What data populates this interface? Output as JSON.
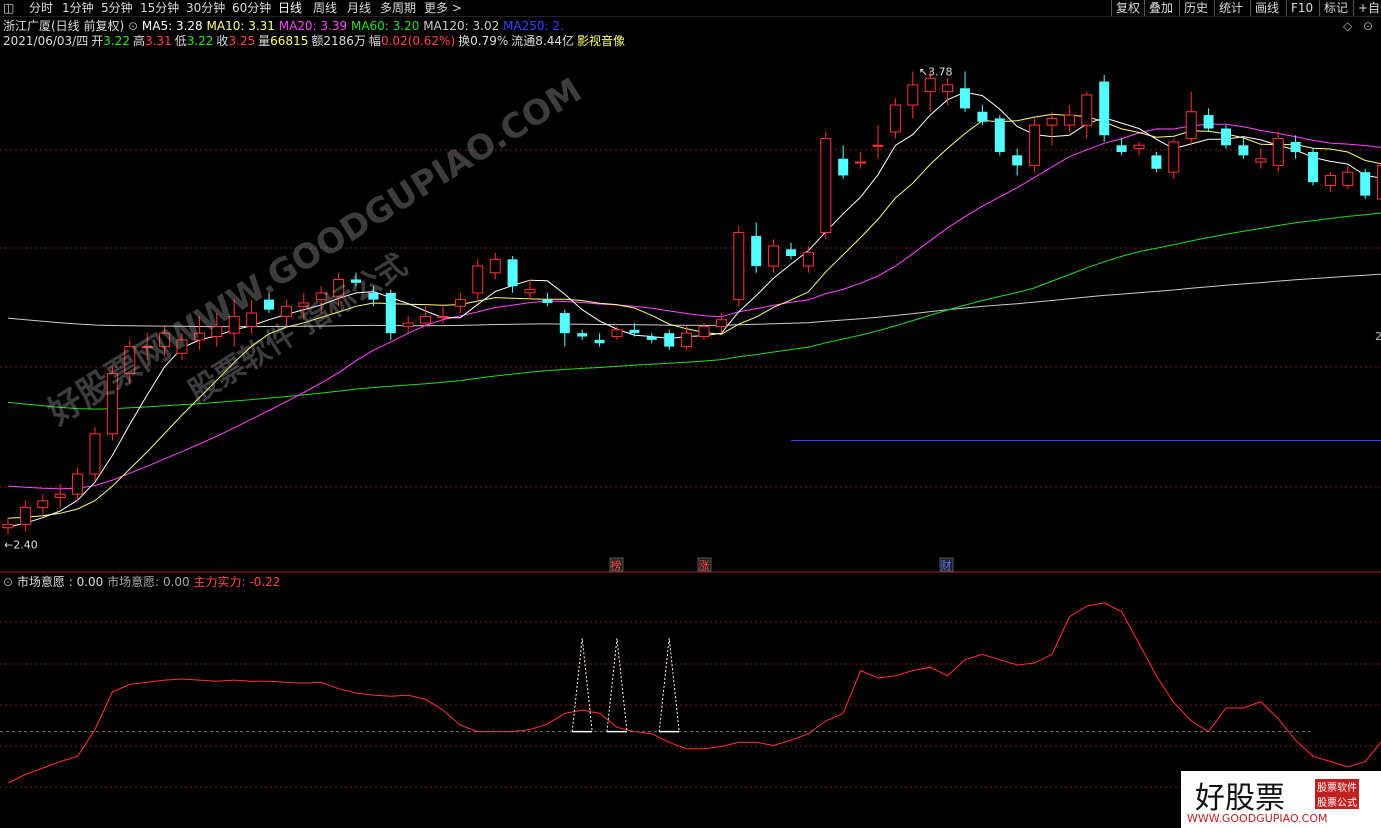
{
  "toolbar": {
    "window_icon": "window-icon",
    "periods": [
      "分时",
      "1分钟",
      "5分钟",
      "15分钟",
      "30分钟",
      "60分钟",
      "日线",
      "周线",
      "月线",
      "多周期",
      "更多 >"
    ],
    "active_period": "日线",
    "right_buttons": [
      "复权",
      "叠加",
      "历史",
      "统计",
      "画线",
      "F10",
      "标记",
      "+自选"
    ]
  },
  "main_info": {
    "title": "浙江广厦(日线 前复权)",
    "ma": [
      {
        "label": "MA5: 3.28",
        "color": "#ffffff"
      },
      {
        "label": "MA10: 3.31",
        "color": "#ffff80"
      },
      {
        "label": "MA20: 3.39",
        "color": "#ff44ff"
      },
      {
        "label": "MA60: 3.20",
        "color": "#22dd22"
      },
      {
        "label": "MA120: 3.02",
        "color": "#cccccc"
      },
      {
        "label": "MA250: 2.",
        "color": "#3344ff"
      }
    ],
    "quote": [
      {
        "label": "2021/06/03/四",
        "color": "#dddddd"
      },
      {
        "label": "开",
        "color": "#dddddd"
      },
      {
        "label": "3.22",
        "color": "#22ee22"
      },
      {
        "label": "高",
        "color": "#dddddd"
      },
      {
        "label": "3.31",
        "color": "#ff4444"
      },
      {
        "label": "低",
        "color": "#dddddd"
      },
      {
        "label": "3.22",
        "color": "#22ee22"
      },
      {
        "label": "收",
        "color": "#dddddd"
      },
      {
        "label": "3.25",
        "color": "#ff4444"
      },
      {
        "label": "量",
        "color": "#dddddd"
      },
      {
        "label": "66815",
        "color": "#ffff66"
      },
      {
        "label": "额",
        "color": "#dddddd"
      },
      {
        "label": "2186万",
        "color": "#dddddd"
      },
      {
        "label": "幅",
        "color": "#dddddd"
      },
      {
        "label": "0.02(0.62%)",
        "color": "#ff4444"
      },
      {
        "label": "换0.79%",
        "color": "#dddddd"
      },
      {
        "label": "流通8.44亿",
        "color": "#dddddd"
      },
      {
        "label": "影视音像",
        "color": "#ffff66"
      }
    ],
    "high_label": "3.78",
    "low_label": "2.40",
    "right_axis_label": "2",
    "events": [
      {
        "label": "榜",
        "color": "#ff4444"
      },
      {
        "label": "涨",
        "color": "#ff4444"
      },
      {
        "label": "财",
        "color": "#5577ff"
      }
    ]
  },
  "sub_info": {
    "indicator": "市场意愿",
    "items": [
      {
        "label": "市场意愿 : 0.00",
        "color": "#dddddd"
      },
      {
        "label": "市场意愿: 0.00",
        "color": "#aaaaaa"
      },
      {
        "label": "主力实力: -0.22",
        "color": "#ff4444"
      }
    ]
  },
  "watermark": {
    "lines": [
      "好股票网WWW.GOODGUPIAO.COM",
      "股票软件 指标公式"
    ],
    "logo_text": "好股票",
    "logo_tags": [
      "股票软件",
      "股票公式"
    ],
    "logo_url": "WWW.GOODGUPIAO.COM"
  },
  "colors": {
    "up": "#ff3333",
    "down": "#54ffff",
    "grid": "#7a1a1a",
    "ma5": "#ffffff",
    "ma10": "#ffff80",
    "ma20": "#ff44ff",
    "ma60": "#22dd22",
    "ma120": "#cccccc",
    "ma250": "#3344ff",
    "indicator_line": "#ff3333",
    "indicator_spike": "#ffffff"
  },
  "chart_data": {
    "type": "candlestick",
    "title": "浙江广厦(日线 前复权)",
    "y_range": [
      2.3,
      3.85
    ],
    "candles": [
      [
        2.42,
        2.45,
        2.4,
        2.43
      ],
      [
        2.43,
        2.5,
        2.41,
        2.48
      ],
      [
        2.48,
        2.52,
        2.46,
        2.5
      ],
      [
        2.51,
        2.55,
        2.48,
        2.52
      ],
      [
        2.52,
        2.6,
        2.5,
        2.58
      ],
      [
        2.58,
        2.72,
        2.56,
        2.7
      ],
      [
        2.7,
        2.9,
        2.68,
        2.88
      ],
      [
        2.88,
        2.98,
        2.85,
        2.96
      ],
      [
        2.96,
        3.0,
        2.92,
        2.96
      ],
      [
        2.96,
        3.02,
        2.93,
        3.0
      ],
      [
        2.94,
        3.0,
        2.92,
        2.98
      ],
      [
        2.98,
        3.05,
        2.95,
        3.0
      ],
      [
        2.99,
        3.06,
        2.96,
        3.02
      ],
      [
        3.0,
        3.1,
        2.96,
        3.05
      ],
      [
        3.02,
        3.1,
        3.0,
        3.06
      ],
      [
        3.1,
        3.12,
        3.06,
        3.07
      ],
      [
        3.05,
        3.1,
        3.02,
        3.08
      ],
      [
        3.08,
        3.12,
        3.04,
        3.09
      ],
      [
        3.1,
        3.14,
        3.06,
        3.12
      ],
      [
        3.11,
        3.18,
        3.08,
        3.16
      ],
      [
        3.16,
        3.18,
        3.14,
        3.15
      ],
      [
        3.12,
        3.14,
        3.08,
        3.1
      ],
      [
        3.12,
        3.13,
        2.98,
        3.0
      ],
      [
        3.02,
        3.05,
        3.0,
        3.03
      ],
      [
        3.03,
        3.08,
        3.02,
        3.05
      ],
      [
        3.05,
        3.08,
        3.03,
        3.05
      ],
      [
        3.08,
        3.12,
        3.06,
        3.1
      ],
      [
        3.12,
        3.22,
        3.1,
        3.2
      ],
      [
        3.18,
        3.24,
        3.16,
        3.22
      ],
      [
        3.22,
        3.23,
        3.12,
        3.14
      ],
      [
        3.12,
        3.16,
        3.1,
        3.13
      ],
      [
        3.1,
        3.12,
        3.08,
        3.09
      ],
      [
        3.06,
        3.07,
        2.96,
        3.0
      ],
      [
        3.0,
        3.01,
        2.98,
        2.99
      ],
      [
        2.98,
        3.0,
        2.96,
        2.97
      ],
      [
        2.99,
        3.02,
        2.98,
        3.01
      ],
      [
        3.01,
        3.03,
        2.99,
        3.0
      ],
      [
        2.99,
        3.0,
        2.97,
        2.98
      ],
      [
        3.0,
        3.01,
        2.95,
        2.96
      ],
      [
        2.96,
        3.02,
        2.95,
        3.0
      ],
      [
        2.99,
        3.03,
        2.98,
        3.02
      ],
      [
        3.02,
        3.06,
        3.0,
        3.04
      ],
      [
        3.1,
        3.32,
        3.08,
        3.3
      ],
      [
        3.29,
        3.33,
        3.18,
        3.2
      ],
      [
        3.2,
        3.28,
        3.18,
        3.26
      ],
      [
        3.25,
        3.27,
        3.22,
        3.23
      ],
      [
        3.2,
        3.26,
        3.18,
        3.24
      ],
      [
        3.3,
        3.6,
        3.28,
        3.58
      ],
      [
        3.52,
        3.56,
        3.46,
        3.47
      ],
      [
        3.51,
        3.54,
        3.49,
        3.51
      ],
      [
        3.56,
        3.62,
        3.52,
        3.56
      ],
      [
        3.6,
        3.7,
        3.58,
        3.68
      ],
      [
        3.68,
        3.78,
        3.64,
        3.74
      ],
      [
        3.72,
        3.78,
        3.66,
        3.76
      ],
      [
        3.72,
        3.76,
        3.68,
        3.74
      ],
      [
        3.73,
        3.78,
        3.66,
        3.67
      ],
      [
        3.66,
        3.68,
        3.62,
        3.63
      ],
      [
        3.64,
        3.65,
        3.53,
        3.54
      ],
      [
        3.53,
        3.55,
        3.47,
        3.5
      ],
      [
        3.5,
        3.64,
        3.48,
        3.62
      ],
      [
        3.62,
        3.66,
        3.56,
        3.64
      ],
      [
        3.62,
        3.68,
        3.6,
        3.65
      ],
      [
        3.62,
        3.72,
        3.58,
        3.71
      ],
      [
        3.75,
        3.77,
        3.57,
        3.59
      ],
      [
        3.56,
        3.58,
        3.53,
        3.54
      ],
      [
        3.55,
        3.57,
        3.53,
        3.56
      ],
      [
        3.53,
        3.54,
        3.48,
        3.49
      ],
      [
        3.48,
        3.58,
        3.46,
        3.57
      ],
      [
        3.58,
        3.72,
        3.56,
        3.66
      ],
      [
        3.65,
        3.67,
        3.6,
        3.61
      ],
      [
        3.61,
        3.62,
        3.55,
        3.56
      ],
      [
        3.56,
        3.58,
        3.52,
        3.53
      ],
      [
        3.51,
        3.55,
        3.49,
        3.52
      ],
      [
        3.5,
        3.6,
        3.48,
        3.58
      ],
      [
        3.57,
        3.59,
        3.52,
        3.54
      ],
      [
        3.54,
        3.55,
        3.44,
        3.45
      ],
      [
        3.44,
        3.48,
        3.42,
        3.47
      ],
      [
        3.44,
        3.5,
        3.43,
        3.48
      ],
      [
        3.48,
        3.49,
        3.4,
        3.41
      ],
      [
        3.4,
        3.52,
        3.38,
        3.5
      ],
      [
        3.48,
        3.49,
        3.44,
        3.45
      ],
      [
        3.46,
        3.47,
        3.44,
        3.45
      ],
      [
        3.46,
        3.5,
        3.38,
        3.4
      ],
      [
        3.4,
        3.42,
        3.36,
        3.38
      ],
      [
        3.38,
        3.42,
        3.36,
        3.37
      ],
      [
        3.34,
        3.38,
        3.3,
        3.32
      ],
      [
        3.22,
        3.31,
        3.22,
        3.25
      ]
    ],
    "ma250": [
      2.95,
      2.94,
      2.93,
      2.92,
      2.91,
      2.9,
      2.89,
      2.88,
      2.87,
      2.86,
      2.85,
      2.84,
      2.83,
      2.82,
      2.81,
      2.8,
      2.79,
      2.78,
      2.77,
      2.76,
      2.75,
      2.75,
      2.74,
      2.74,
      2.73,
      2.72,
      2.72,
      2.71,
      2.71,
      2.7,
      2.7,
      2.7,
      2.69,
      2.69,
      2.69,
      2.69,
      2.68,
      2.68,
      2.68,
      2.68,
      2.68,
      2.68,
      2.68,
      2.68,
      2.68,
      2.68,
      2.68,
      2.68,
      2.68,
      2.68,
      2.68,
      2.68,
      2.68,
      2.68,
      2.68,
      2.68,
      2.68,
      2.68,
      2.68,
      2.68,
      2.68,
      2.68,
      2.68,
      2.68,
      2.68,
      2.68,
      2.68,
      2.68,
      2.68,
      2.68,
      2.68,
      2.68,
      2.68,
      2.68,
      2.68,
      2.68,
      2.68,
      2.68,
      2.68,
      2.68,
      2.68,
      2.68,
      2.68,
      2.68,
      2.68,
      2.68,
      2.68
    ],
    "indicator": {
      "name": "市场意愿",
      "y_range": [
        -1.0,
        1.2
      ],
      "values": [
        -0.6,
        -0.52,
        -0.46,
        -0.4,
        -0.35,
        -0.1,
        0.25,
        0.32,
        0.34,
        0.36,
        0.37,
        0.36,
        0.35,
        0.36,
        0.35,
        0.35,
        0.34,
        0.33,
        0.34,
        0.28,
        0.24,
        0.22,
        0.21,
        0.22,
        0.18,
        0.08,
        -0.06,
        -0.12,
        -0.12,
        -0.12,
        -0.1,
        -0.05,
        0.05,
        0.08,
        0.05,
        -0.08,
        -0.12,
        -0.14,
        -0.22,
        -0.28,
        -0.28,
        -0.26,
        -0.22,
        -0.22,
        -0.25,
        -0.2,
        -0.14,
        -0.02,
        0.05,
        0.45,
        0.38,
        0.4,
        0.45,
        0.48,
        0.4,
        0.55,
        0.6,
        0.55,
        0.5,
        0.52,
        0.6,
        0.95,
        1.05,
        1.08,
        1.0,
        0.7,
        0.4,
        0.15,
        -0.02,
        -0.12,
        0.1,
        0.1,
        0.16,
        0.0,
        -0.2,
        -0.35,
        -0.4,
        -0.45,
        -0.4,
        -0.2,
        -0.05,
        -0.18,
        -0.35,
        -0.42,
        -0.48,
        -0.55,
        -0.7,
        -0.75,
        -0.65,
        -0.7
      ],
      "spikes": [
        33,
        35,
        38
      ]
    }
  }
}
